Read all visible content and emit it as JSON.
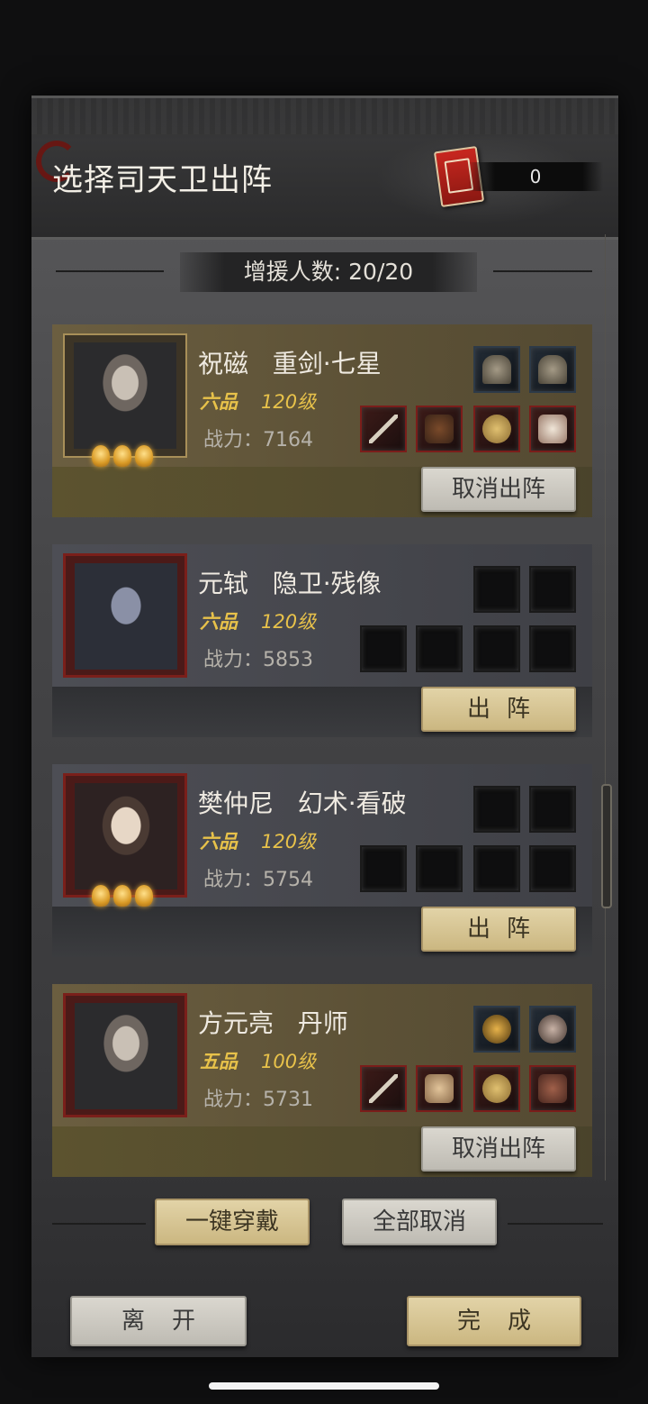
{
  "header": {
    "title": "选择司天卫出阵",
    "token_count": "0",
    "token_icon": "ledger-book-icon"
  },
  "reinforce": {
    "label": "增援人数: 20/20"
  },
  "cards": [
    {
      "name": "祝磁   重剑·七星",
      "rank": "六品",
      "level": "120级",
      "power": "战力：7164",
      "button": "取消出阵",
      "selected": true
    },
    {
      "name": "元轼   隐卫·残像",
      "rank": "六品",
      "level": "120级",
      "power": "战力：5853",
      "button": "出阵",
      "selected": false
    },
    {
      "name": "樊仲尼   幻术·看破",
      "rank": "六品",
      "level": "120级",
      "power": "战力：5754",
      "button": "出阵",
      "selected": false
    },
    {
      "name": "方元亮   丹师",
      "rank": "五品",
      "level": "100级",
      "power": "战力：5731",
      "button": "取消出阵",
      "selected": true
    }
  ],
  "actions": {
    "equip_all": "一键穿戴",
    "cancel_all": "全部取消",
    "leave": "离开",
    "done": "完成"
  },
  "colors": {
    "gold": "#e8c24a",
    "accent_red": "#7a1f1a"
  }
}
